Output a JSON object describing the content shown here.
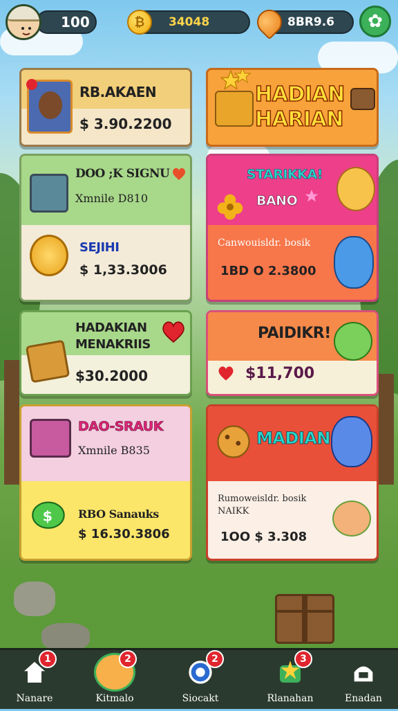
{
  "top_bar": {
    "level": "100",
    "coins": "34048",
    "gems": "8BR9.6",
    "coin_symbol": "₿",
    "gift_symbol": "✿"
  },
  "cards": {
    "c1": {
      "title": "RB.AKAEN",
      "price": "$ 3.90.2200"
    },
    "c2": {
      "title_line1": "HADIAN",
      "title_line2": "HARIAN"
    },
    "c3": {
      "title": "DOO ;K SIGNU",
      "subtitle": "Xmnile D810",
      "badge_title": "SEJIHI",
      "price": "$ 1,33.3006"
    },
    "c4": {
      "title": "STARIKKA!",
      "subtitle": "BANO",
      "desc": "Canwouisldr. bosik",
      "price": "1BD O 2.3800"
    },
    "c5": {
      "title_line1": "HADAKIAN",
      "title_line2": "MENAKRIIS",
      "price": "$30.2000"
    },
    "c6": {
      "title": "PAIDIKR!",
      "price": "$11,700"
    },
    "c7": {
      "title": "DAO-SRAUK",
      "subtitle": "Xmnile B835",
      "tag": "RBO Sanauks",
      "price": "$ 16.30.3806"
    },
    "c8": {
      "title": "MADIAN",
      "desc_line1": "Rumoweisldr. bosik",
      "desc_line2": "NAIKK",
      "price": "1OO $ 3.308"
    }
  },
  "nav": [
    {
      "label": "Nanare",
      "badge": "1"
    },
    {
      "label": "Kitmalo",
      "badge": "2"
    },
    {
      "label": "Siocakt",
      "badge": "2"
    },
    {
      "label": "Rlanahan",
      "badge": "3"
    },
    {
      "label": "Enadan",
      "badge": ""
    }
  ],
  "colors": {
    "accent_red": "#e0252e",
    "coin_gold": "#ffd54a",
    "nav_bg": "#2b3a2e"
  }
}
